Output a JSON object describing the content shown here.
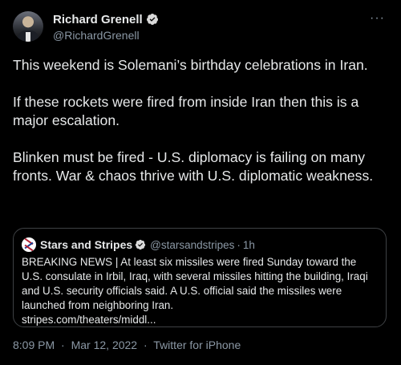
{
  "author": {
    "name": "Richard Grenell",
    "handle": "@RichardGrenell",
    "verified": true
  },
  "menu": {
    "more_label": "···"
  },
  "tweet": {
    "paragraphs": [
      "This weekend is Solemani’s birthday celebrations in Iran.",
      "If these rockets were fired from inside Iran then this is a major escalation.",
      "Blinken must be fired - U.S. diplomacy is failing on many fronts. War & chaos thrive with U.S. diplomatic weakness."
    ]
  },
  "quoted": {
    "name": "Stars and Stripes",
    "handle": "@starsandstripes",
    "separator": "·",
    "time": "1h",
    "text": "BREAKING NEWS | At least six missiles were fired Sunday toward the U.S. consulate in Irbil, Iraq, with several missiles hitting the building, Iraqi and U.S. security officials said. A U.S. official said the missiles were launched from neighboring Iran.",
    "link": "stripes.com/theaters/middl..."
  },
  "meta": {
    "time": "8:09 PM",
    "sep1": "·",
    "date": "Mar 12, 2022",
    "sep2": "·",
    "source": "Twitter for iPhone"
  },
  "colors": {
    "background": "#000000",
    "text": "#e7e9ea",
    "secondary": "#8b98a5",
    "border": "#3e4144",
    "verified_badge": "#d9d9d9"
  }
}
